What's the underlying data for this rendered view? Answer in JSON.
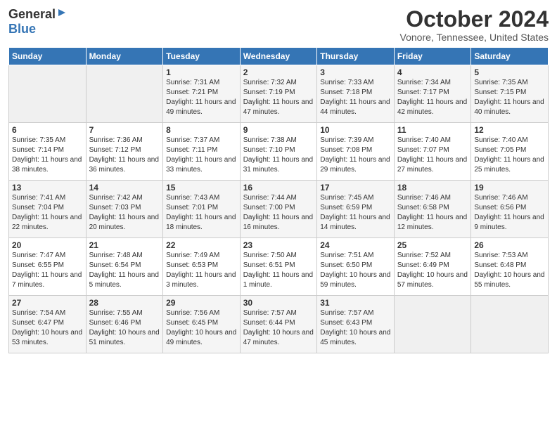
{
  "logo": {
    "general": "General",
    "blue": "Blue"
  },
  "title": "October 2024",
  "location": "Vonore, Tennessee, United States",
  "days_of_week": [
    "Sunday",
    "Monday",
    "Tuesday",
    "Wednesday",
    "Thursday",
    "Friday",
    "Saturday"
  ],
  "weeks": [
    [
      {
        "day": "",
        "sunrise": "",
        "sunset": "",
        "daylight": ""
      },
      {
        "day": "",
        "sunrise": "",
        "sunset": "",
        "daylight": ""
      },
      {
        "day": "1",
        "sunrise": "Sunrise: 7:31 AM",
        "sunset": "Sunset: 7:21 PM",
        "daylight": "Daylight: 11 hours and 49 minutes."
      },
      {
        "day": "2",
        "sunrise": "Sunrise: 7:32 AM",
        "sunset": "Sunset: 7:19 PM",
        "daylight": "Daylight: 11 hours and 47 minutes."
      },
      {
        "day": "3",
        "sunrise": "Sunrise: 7:33 AM",
        "sunset": "Sunset: 7:18 PM",
        "daylight": "Daylight: 11 hours and 44 minutes."
      },
      {
        "day": "4",
        "sunrise": "Sunrise: 7:34 AM",
        "sunset": "Sunset: 7:17 PM",
        "daylight": "Daylight: 11 hours and 42 minutes."
      },
      {
        "day": "5",
        "sunrise": "Sunrise: 7:35 AM",
        "sunset": "Sunset: 7:15 PM",
        "daylight": "Daylight: 11 hours and 40 minutes."
      }
    ],
    [
      {
        "day": "6",
        "sunrise": "Sunrise: 7:35 AM",
        "sunset": "Sunset: 7:14 PM",
        "daylight": "Daylight: 11 hours and 38 minutes."
      },
      {
        "day": "7",
        "sunrise": "Sunrise: 7:36 AM",
        "sunset": "Sunset: 7:12 PM",
        "daylight": "Daylight: 11 hours and 36 minutes."
      },
      {
        "day": "8",
        "sunrise": "Sunrise: 7:37 AM",
        "sunset": "Sunset: 7:11 PM",
        "daylight": "Daylight: 11 hours and 33 minutes."
      },
      {
        "day": "9",
        "sunrise": "Sunrise: 7:38 AM",
        "sunset": "Sunset: 7:10 PM",
        "daylight": "Daylight: 11 hours and 31 minutes."
      },
      {
        "day": "10",
        "sunrise": "Sunrise: 7:39 AM",
        "sunset": "Sunset: 7:08 PM",
        "daylight": "Daylight: 11 hours and 29 minutes."
      },
      {
        "day": "11",
        "sunrise": "Sunrise: 7:40 AM",
        "sunset": "Sunset: 7:07 PM",
        "daylight": "Daylight: 11 hours and 27 minutes."
      },
      {
        "day": "12",
        "sunrise": "Sunrise: 7:40 AM",
        "sunset": "Sunset: 7:05 PM",
        "daylight": "Daylight: 11 hours and 25 minutes."
      }
    ],
    [
      {
        "day": "13",
        "sunrise": "Sunrise: 7:41 AM",
        "sunset": "Sunset: 7:04 PM",
        "daylight": "Daylight: 11 hours and 22 minutes."
      },
      {
        "day": "14",
        "sunrise": "Sunrise: 7:42 AM",
        "sunset": "Sunset: 7:03 PM",
        "daylight": "Daylight: 11 hours and 20 minutes."
      },
      {
        "day": "15",
        "sunrise": "Sunrise: 7:43 AM",
        "sunset": "Sunset: 7:01 PM",
        "daylight": "Daylight: 11 hours and 18 minutes."
      },
      {
        "day": "16",
        "sunrise": "Sunrise: 7:44 AM",
        "sunset": "Sunset: 7:00 PM",
        "daylight": "Daylight: 11 hours and 16 minutes."
      },
      {
        "day": "17",
        "sunrise": "Sunrise: 7:45 AM",
        "sunset": "Sunset: 6:59 PM",
        "daylight": "Daylight: 11 hours and 14 minutes."
      },
      {
        "day": "18",
        "sunrise": "Sunrise: 7:46 AM",
        "sunset": "Sunset: 6:58 PM",
        "daylight": "Daylight: 11 hours and 12 minutes."
      },
      {
        "day": "19",
        "sunrise": "Sunrise: 7:46 AM",
        "sunset": "Sunset: 6:56 PM",
        "daylight": "Daylight: 11 hours and 9 minutes."
      }
    ],
    [
      {
        "day": "20",
        "sunrise": "Sunrise: 7:47 AM",
        "sunset": "Sunset: 6:55 PM",
        "daylight": "Daylight: 11 hours and 7 minutes."
      },
      {
        "day": "21",
        "sunrise": "Sunrise: 7:48 AM",
        "sunset": "Sunset: 6:54 PM",
        "daylight": "Daylight: 11 hours and 5 minutes."
      },
      {
        "day": "22",
        "sunrise": "Sunrise: 7:49 AM",
        "sunset": "Sunset: 6:53 PM",
        "daylight": "Daylight: 11 hours and 3 minutes."
      },
      {
        "day": "23",
        "sunrise": "Sunrise: 7:50 AM",
        "sunset": "Sunset: 6:51 PM",
        "daylight": "Daylight: 11 hours and 1 minute."
      },
      {
        "day": "24",
        "sunrise": "Sunrise: 7:51 AM",
        "sunset": "Sunset: 6:50 PM",
        "daylight": "Daylight: 10 hours and 59 minutes."
      },
      {
        "day": "25",
        "sunrise": "Sunrise: 7:52 AM",
        "sunset": "Sunset: 6:49 PM",
        "daylight": "Daylight: 10 hours and 57 minutes."
      },
      {
        "day": "26",
        "sunrise": "Sunrise: 7:53 AM",
        "sunset": "Sunset: 6:48 PM",
        "daylight": "Daylight: 10 hours and 55 minutes."
      }
    ],
    [
      {
        "day": "27",
        "sunrise": "Sunrise: 7:54 AM",
        "sunset": "Sunset: 6:47 PM",
        "daylight": "Daylight: 10 hours and 53 minutes."
      },
      {
        "day": "28",
        "sunrise": "Sunrise: 7:55 AM",
        "sunset": "Sunset: 6:46 PM",
        "daylight": "Daylight: 10 hours and 51 minutes."
      },
      {
        "day": "29",
        "sunrise": "Sunrise: 7:56 AM",
        "sunset": "Sunset: 6:45 PM",
        "daylight": "Daylight: 10 hours and 49 minutes."
      },
      {
        "day": "30",
        "sunrise": "Sunrise: 7:57 AM",
        "sunset": "Sunset: 6:44 PM",
        "daylight": "Daylight: 10 hours and 47 minutes."
      },
      {
        "day": "31",
        "sunrise": "Sunrise: 7:57 AM",
        "sunset": "Sunset: 6:43 PM",
        "daylight": "Daylight: 10 hours and 45 minutes."
      },
      {
        "day": "",
        "sunrise": "",
        "sunset": "",
        "daylight": ""
      },
      {
        "day": "",
        "sunrise": "",
        "sunset": "",
        "daylight": ""
      }
    ]
  ]
}
